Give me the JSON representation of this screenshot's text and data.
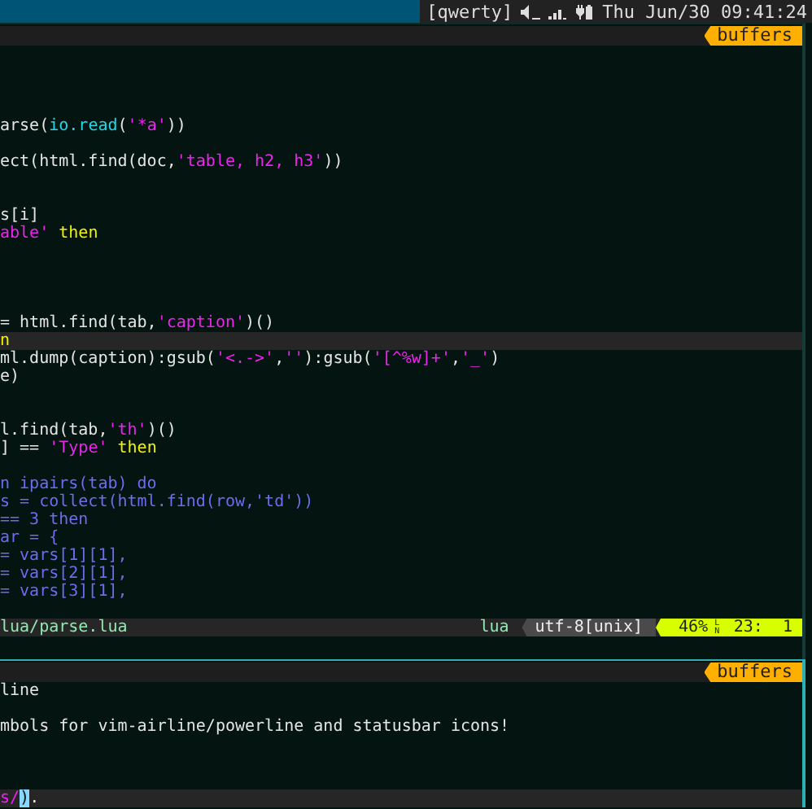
{
  "top_bar": {
    "layout": "[qwerty]",
    "clock": "Thu Jun/30 09:41:24"
  },
  "panes": [
    {
      "buffers_tag": "buffers",
      "active": false,
      "lines": [
        {
          "current": false
        },
        {
          "current": false
        },
        {
          "current": false
        },
        {
          "current": false
        },
        {
          "current": false,
          "segments": [
            {
              "text": "arse(",
              "kind": "plain"
            },
            {
              "text": "io.read",
              "kind": "builtin"
            },
            {
              "text": "(",
              "kind": "plain"
            },
            {
              "text": "'*a'",
              "kind": "string"
            },
            {
              "text": "))",
              "kind": "plain"
            }
          ]
        },
        {
          "current": false
        },
        {
          "current": false,
          "segments": [
            {
              "text": "ect(html.find(doc,",
              "kind": "plain"
            },
            {
              "text": "'table, h2, h3'",
              "kind": "string"
            },
            {
              "text": "))",
              "kind": "plain"
            }
          ]
        },
        {
          "current": false
        },
        {
          "current": false
        },
        {
          "current": false,
          "segments": [
            {
              "text": "s[i]",
              "kind": "plain"
            }
          ]
        },
        {
          "current": false,
          "segments": [
            {
              "text": "able'",
              "kind": "string"
            },
            {
              "text": " then",
              "kind": "keyword"
            }
          ]
        },
        {
          "current": false
        },
        {
          "current": false
        },
        {
          "current": false
        },
        {
          "current": false
        },
        {
          "current": false,
          "segments": [
            {
              "text": "= html.find(tab,",
              "kind": "plain"
            },
            {
              "text": "'caption'",
              "kind": "string"
            },
            {
              "text": ")()",
              "kind": "plain"
            }
          ]
        },
        {
          "current": true,
          "segments": [
            {
              "text": "n",
              "kind": "keyword"
            }
          ]
        },
        {
          "current": false,
          "segments": [
            {
              "text": "ml.dump(caption):gsub(",
              "kind": "plain"
            },
            {
              "text": "'<.->'",
              "kind": "string"
            },
            {
              "text": ",",
              "kind": "plain"
            },
            {
              "text": "''",
              "kind": "string"
            },
            {
              "text": "):gsub(",
              "kind": "plain"
            },
            {
              "text": "'[^%w]+'",
              "kind": "string"
            },
            {
              "text": ",",
              "kind": "plain"
            },
            {
              "text": "'_'",
              "kind": "string"
            },
            {
              "text": ")",
              "kind": "plain"
            }
          ]
        },
        {
          "current": false,
          "segments": [
            {
              "text": "e)",
              "kind": "plain"
            }
          ]
        },
        {
          "current": false
        },
        {
          "current": false
        },
        {
          "current": false,
          "segments": [
            {
              "text": "l.find(tab,",
              "kind": "plain"
            },
            {
              "text": "'th'",
              "kind": "string"
            },
            {
              "text": ")()",
              "kind": "plain"
            }
          ]
        },
        {
          "current": false,
          "segments": [
            {
              "text": "] == ",
              "kind": "plain"
            },
            {
              "text": "'Type'",
              "kind": "string"
            },
            {
              "text": " then",
              "kind": "keyword"
            }
          ]
        },
        {
          "current": false
        },
        {
          "current": false,
          "segments": [
            {
              "text": "n ipairs(tab) do",
              "kind": "loop"
            }
          ]
        },
        {
          "current": false,
          "segments": [
            {
              "text": "s = collect(html.find(row,'td'))",
              "kind": "loop"
            }
          ]
        },
        {
          "current": false,
          "segments": [
            {
              "text": "== 3 then",
              "kind": "loop"
            }
          ]
        },
        {
          "current": false,
          "segments": [
            {
              "text": "ar = {",
              "kind": "loop"
            }
          ]
        },
        {
          "current": false,
          "segments": [
            {
              "text": "= vars[1][1],",
              "kind": "loop"
            }
          ]
        },
        {
          "current": false,
          "segments": [
            {
              "text": "= vars[2][1],",
              "kind": "loop"
            }
          ]
        },
        {
          "current": false,
          "segments": [
            {
              "text": "= vars[3][1],",
              "kind": "loop"
            }
          ]
        },
        {
          "current": false
        }
      ],
      "status": {
        "file": "lua/parse.lua",
        "filetype": "lua",
        "encoding": "utf-8[unix]",
        "percent": "46%",
        "ln_symbol": {
          "top": "L",
          "bottom": "N"
        },
        "position": "23:  1"
      }
    },
    {
      "buffers_tag": "buffers",
      "active": true,
      "lines": [
        {
          "current": false,
          "segments": [
            {
              "text": "line",
              "kind": "plain"
            }
          ]
        },
        {
          "current": false
        },
        {
          "current": false,
          "segments": [
            {
              "text": "mbols for vim-airline/powerline and statusbar icons!",
              "kind": "plain"
            }
          ]
        },
        {
          "current": false
        },
        {
          "current": false
        },
        {
          "current": false
        },
        {
          "current": true,
          "segments": [
            {
              "text": "s/",
              "kind": "string"
            },
            {
              "text": ")",
              "kind": "cursor"
            },
            {
              "text": ".",
              "kind": "plain"
            }
          ]
        }
      ]
    }
  ]
}
